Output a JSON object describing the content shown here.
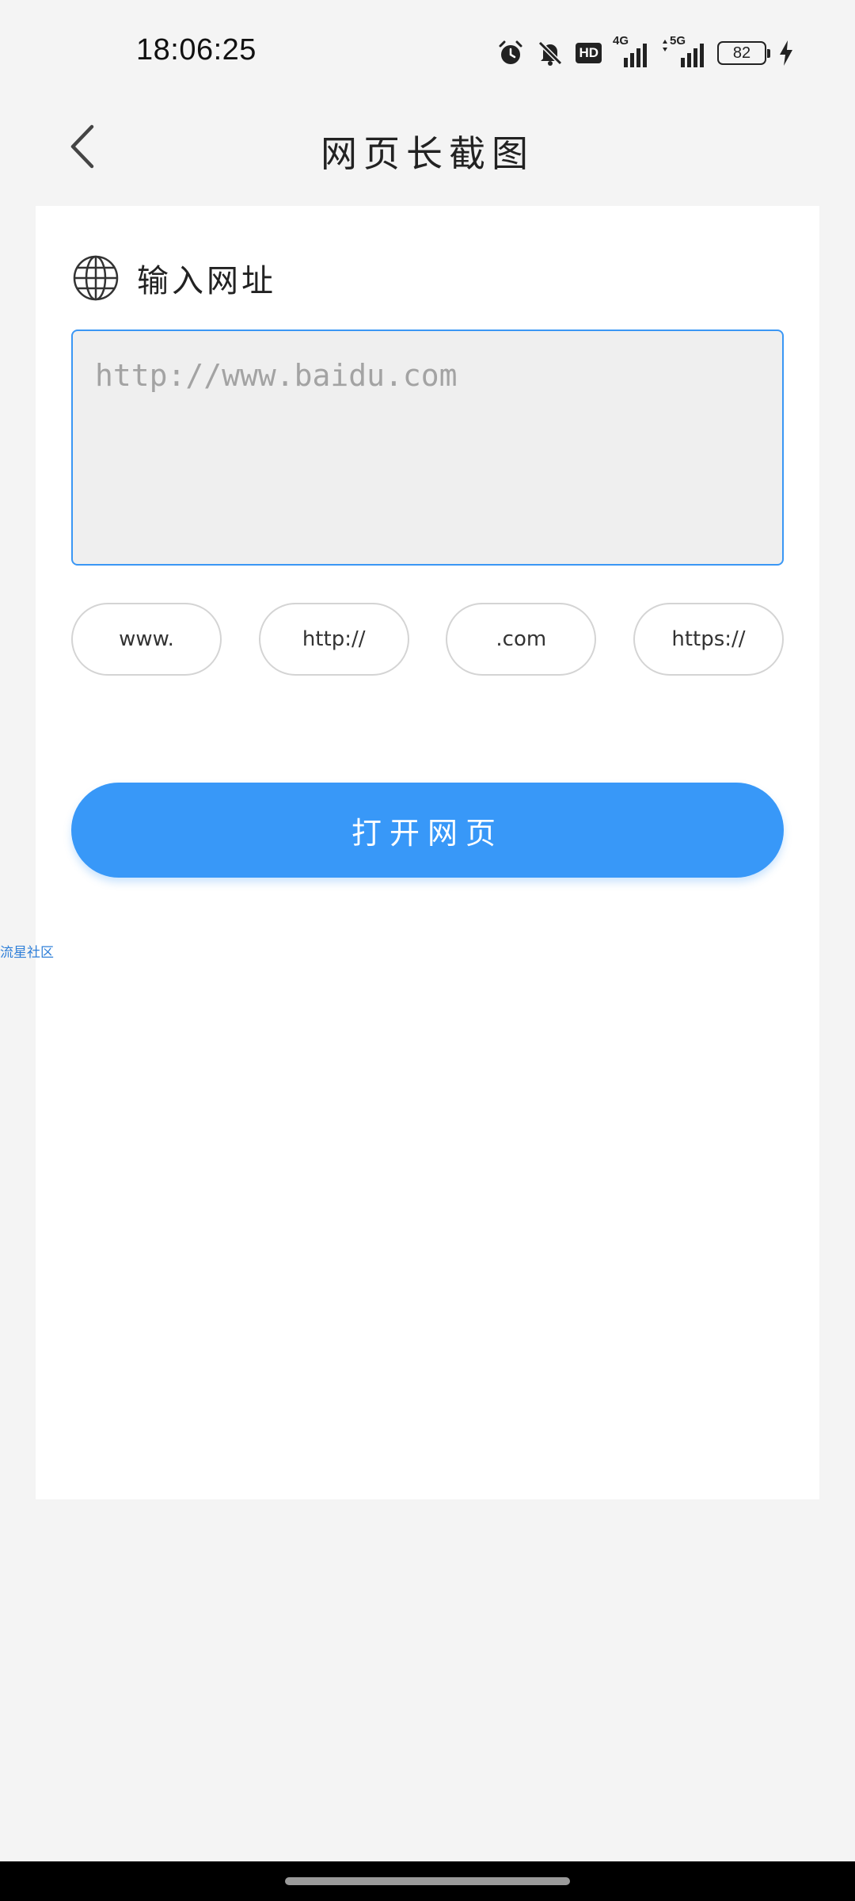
{
  "status_bar": {
    "time": "18:06:25",
    "icons": [
      "alarm-icon",
      "mute-bell-icon",
      "hd-voice-icon",
      "4g-signal-icon",
      "5g-signal-icon",
      "battery-icon",
      "charging-bolt-icon"
    ],
    "hd_label": "HD",
    "signal_4g_label": "4G",
    "signal_5g_label": "5G",
    "battery_level": "82"
  },
  "header": {
    "title": "网页长截图",
    "back_icon": "chevron-left-icon"
  },
  "form": {
    "label": "输入网址",
    "label_icon": "globe-icon",
    "input_value": "",
    "input_placeholder": "http://www.baidu.com",
    "accent_color": "#3a97f5",
    "chips": [
      {
        "label": "www."
      },
      {
        "label": "http://"
      },
      {
        "label": ".com"
      },
      {
        "label": "https://"
      }
    ],
    "submit_label": "打开网页",
    "submit_color": "#3898f8"
  },
  "watermark": "流星社区"
}
